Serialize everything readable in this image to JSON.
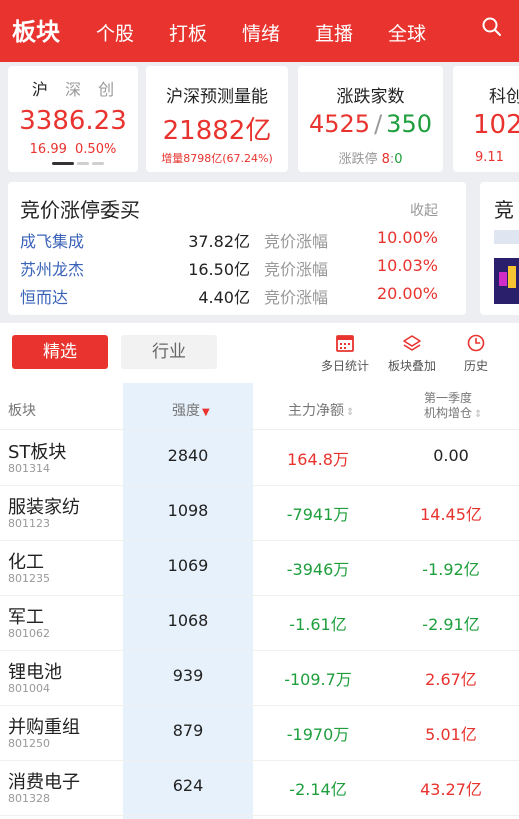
{
  "header": {
    "title": "板块",
    "nav": [
      "个股",
      "打板",
      "情绪",
      "直播",
      "全球"
    ]
  },
  "index_card": {
    "tabs": [
      "沪",
      "深",
      "创"
    ],
    "value": "3386.23",
    "change": "16.99",
    "change_pct": "0.50%"
  },
  "volume_card": {
    "title": "沪深预测量能",
    "value": "21882亿",
    "sub_label": "增量",
    "sub_value": "8798亿(67.24%)"
  },
  "breadth_card": {
    "title": "涨跌家数",
    "up": "4525",
    "sep": "/",
    "down": "350",
    "limit_label": "涨跌停",
    "limit_up": "8",
    "limit_sep": ":",
    "limit_down": "0"
  },
  "peek_card": {
    "title": "科创",
    "value": "102",
    "sub": "9.11"
  },
  "auction": {
    "title": "竞价涨停委买",
    "collapse_label": "收起",
    "rows": [
      {
        "name": "成飞集成",
        "amount": "37.82亿",
        "label": "竞价涨幅",
        "pct": "10.00%"
      },
      {
        "name": "苏州龙杰",
        "amount": "16.50亿",
        "label": "竞价涨幅",
        "pct": "10.03%"
      },
      {
        "name": "恒而达",
        "amount": "4.40亿",
        "label": "竞价涨幅",
        "pct": "20.00%"
      }
    ],
    "peek_title": "竞"
  },
  "tabs": {
    "selected": "精选",
    "other": "行业"
  },
  "tools": {
    "multi_day": "多日统计",
    "overlay": "板块叠加",
    "history": "历史"
  },
  "table": {
    "headers": {
      "sector": "板块",
      "strength": "强度",
      "net_flow": "主力净额",
      "inst_line1": "第一季度",
      "inst_line2": "机构增仓"
    },
    "rows": [
      {
        "name": "ST板块",
        "code": "801314",
        "strength": "2840",
        "net_flow": "164.8万",
        "net_color": "red",
        "inst": "0.00",
        "inst_color": "black"
      },
      {
        "name": "服装家纺",
        "code": "801123",
        "strength": "1098",
        "net_flow": "-7941万",
        "net_color": "green",
        "inst": "14.45亿",
        "inst_color": "red"
      },
      {
        "name": "化工",
        "code": "801235",
        "strength": "1069",
        "net_flow": "-3946万",
        "net_color": "green",
        "inst": "-1.92亿",
        "inst_color": "green"
      },
      {
        "name": "军工",
        "code": "801062",
        "strength": "1068",
        "net_flow": "-1.61亿",
        "net_color": "green",
        "inst": "-2.91亿",
        "inst_color": "green"
      },
      {
        "name": "锂电池",
        "code": "801004",
        "strength": "939",
        "net_flow": "-109.7万",
        "net_color": "green",
        "inst": "2.67亿",
        "inst_color": "red"
      },
      {
        "name": "并购重组",
        "code": "801250",
        "strength": "879",
        "net_flow": "-1970万",
        "net_color": "green",
        "inst": "5.01亿",
        "inst_color": "red"
      },
      {
        "name": "消费电子",
        "code": "801328",
        "strength": "624",
        "net_flow": "-2.14亿",
        "net_color": "green",
        "inst": "43.27亿",
        "inst_color": "red"
      }
    ]
  },
  "colors": {
    "accent": "#e8332e",
    "up": "#e8332e",
    "down": "#1e9e3c",
    "link": "#3a63b8"
  }
}
